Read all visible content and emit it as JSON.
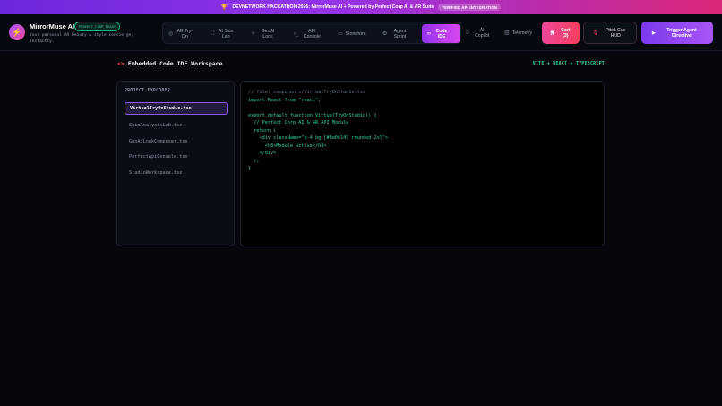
{
  "banner": {
    "icon": "trophy-icon",
    "text": "DEVNETWORK HACKATHON 2026: MirrorMuse AI + Powered by Perfect Corp AI & AR Suite",
    "badge": "VERIFIED API INTEGRATION"
  },
  "brand": {
    "title": "MirrorMuse AI",
    "badge": "PERFECT_CORP_READY",
    "subtitle": "Your personal AR beauty & style concierge, instantly."
  },
  "nav": [
    {
      "label": "AR Try-On",
      "icon": "camera-icon"
    },
    {
      "label": "AI Skin Lab",
      "icon": "scan-icon"
    },
    {
      "label": "GenAI Look",
      "icon": "sparkles-icon"
    },
    {
      "label": "API Console",
      "icon": "terminal-icon"
    },
    {
      "label": "Storefront",
      "icon": "bag-icon"
    },
    {
      "label": "Agent Sprint",
      "icon": "gear-icon"
    },
    {
      "label": "Code IDE",
      "icon": "code-icon",
      "active": true
    },
    {
      "label": "AI Copilot",
      "icon": "bot-icon"
    },
    {
      "label": "Telemetry",
      "icon": "chart-icon"
    }
  ],
  "cart": {
    "label": "Cart (3)",
    "icon": "cart-icon"
  },
  "pitch": {
    "label": "Pitch Cue HUD",
    "icon": "mic-icon"
  },
  "trigger": {
    "label": "Trigger Agent Directive",
    "icon": "play-icon"
  },
  "workspace": {
    "title": "Embedded Code IDE Workspace",
    "tag": "VITE + REACT + TYPESCRIPT"
  },
  "explorer": {
    "title": "PROJECT EXPLORER",
    "files": [
      {
        "name": "VirtualTryOnStudio.tsx",
        "active": true
      },
      {
        "name": "SkinAnalysisLab.tsx"
      },
      {
        "name": "GenAiLookComposer.tsx"
      },
      {
        "name": "PerfectApiConsole.tsx"
      },
      {
        "name": "StudioWorkspace.tsx"
      }
    ]
  },
  "editor": {
    "lines": [
      {
        "text": "// file: components/VirtualTryOnStudio.tsx",
        "type": "comment"
      },
      {
        "text": "import React from \"react\";",
        "type": "code"
      },
      {
        "text": "",
        "type": "code"
      },
      {
        "text": "export default function VirtualTryOnStudio() {",
        "type": "code"
      },
      {
        "text": "  // Perfect Corp AI & AR API Module",
        "type": "code"
      },
      {
        "text": "  return (",
        "type": "code"
      },
      {
        "text": "    <div className=\"p-4 bg-[#0a0d14] rounded-2xl\">",
        "type": "code"
      },
      {
        "text": "      <h3>Module Active</h3>",
        "type": "code"
      },
      {
        "text": "    </div>",
        "type": "code"
      },
      {
        "text": "  );",
        "type": "code"
      },
      {
        "text": "}",
        "type": "code"
      }
    ]
  }
}
